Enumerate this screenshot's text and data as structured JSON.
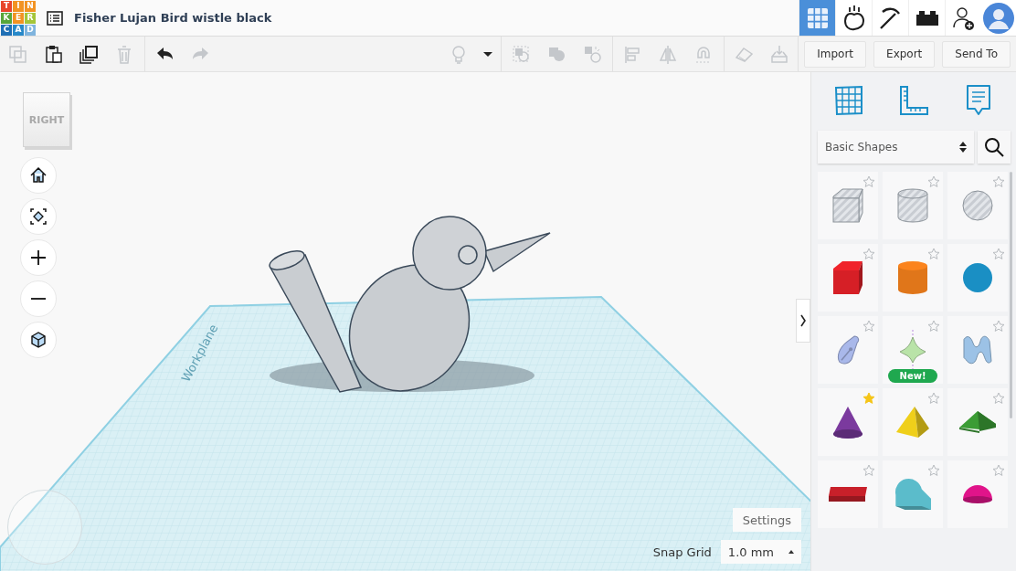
{
  "header": {
    "logo": [
      {
        "letter": "T",
        "color": "#e8452c"
      },
      {
        "letter": "I",
        "color": "#f29322"
      },
      {
        "letter": "N",
        "color": "#f29322"
      },
      {
        "letter": "K",
        "color": "#57a63a"
      },
      {
        "letter": "E",
        "color": "#f29322"
      },
      {
        "letter": "R",
        "color": "#a4c539"
      },
      {
        "letter": "C",
        "color": "#1f6fb5"
      },
      {
        "letter": "A",
        "color": "#2889c9"
      },
      {
        "letter": "D",
        "color": "#7fb4de"
      }
    ],
    "title": "Fisher Lujan Bird wistle black",
    "modes": [
      {
        "kind": "grid",
        "selected": true
      },
      {
        "kind": "apple",
        "selected": false
      },
      {
        "kind": "pickaxe",
        "selected": false
      },
      {
        "kind": "brick",
        "selected": false
      }
    ]
  },
  "toolbar": {
    "tools": [
      {
        "kind": "copy",
        "disabled": true
      },
      {
        "kind": "paste",
        "disabled": false
      },
      {
        "kind": "duplicate",
        "disabled": false
      },
      {
        "kind": "trash",
        "disabled": true
      },
      {
        "kind": "sep"
      },
      {
        "kind": "undo",
        "disabled": false
      },
      {
        "kind": "redo",
        "disabled": true
      }
    ],
    "tools_right": [
      {
        "kind": "bulb",
        "disabled": true
      },
      {
        "kind": "caret",
        "disabled": false
      },
      {
        "kind": "sep"
      },
      {
        "kind": "group",
        "disabled": true
      },
      {
        "kind": "ungroup",
        "disabled": true
      },
      {
        "kind": "hole",
        "disabled": true
      },
      {
        "kind": "sep"
      },
      {
        "kind": "align",
        "disabled": true
      },
      {
        "kind": "mirror",
        "disabled": true
      },
      {
        "kind": "magnet",
        "disabled": true
      },
      {
        "kind": "sep"
      },
      {
        "kind": "plane",
        "disabled": true
      },
      {
        "kind": "drop",
        "disabled": true
      }
    ],
    "buttons": [
      "Import",
      "Export",
      "Send To"
    ]
  },
  "viewcube": {
    "label": "RIGHT"
  },
  "nav": [
    {
      "kind": "home"
    },
    {
      "kind": "fit"
    },
    {
      "kind": "zoom-in"
    },
    {
      "kind": "zoom-out"
    },
    {
      "kind": "ortho"
    }
  ],
  "workplane": {
    "label": "Workplane"
  },
  "settings": "Settings",
  "snap": {
    "label": "Snap Grid",
    "value": "1.0 mm"
  },
  "library": {
    "category": "Basic Shapes",
    "shapes": [
      {
        "kind": "box",
        "color": "#c8ccd2",
        "hole": true,
        "starred": false
      },
      {
        "kind": "cylinder",
        "color": "#c8ccd2",
        "hole": true,
        "starred": false
      },
      {
        "kind": "sphere",
        "color": "#c8ccd2",
        "hole": true,
        "starred": false
      },
      {
        "kind": "box",
        "color": "#d61f26",
        "hole": false,
        "starred": false
      },
      {
        "kind": "cylinder",
        "color": "#e0761a",
        "hole": false,
        "starred": false
      },
      {
        "kind": "sphere",
        "color": "#1a8fc4",
        "hole": false,
        "starred": false
      },
      {
        "kind": "scribble",
        "color": "#a9b8ea",
        "hole": false,
        "starred": false
      },
      {
        "kind": "spinner",
        "color": "#b9e3a8",
        "hole": false,
        "starred": false,
        "badge": "New!"
      },
      {
        "kind": "wave",
        "color": "#9cc2e6",
        "hole": false,
        "starred": false
      },
      {
        "kind": "cone",
        "color": "#7b3a9e",
        "hole": false,
        "starred": true
      },
      {
        "kind": "pyramid",
        "color": "#efcf1a",
        "hole": false,
        "starred": false
      },
      {
        "kind": "roof",
        "color": "#3b9c35",
        "hole": false,
        "starred": false
      },
      {
        "kind": "text",
        "color": "#c8202a",
        "hole": false,
        "starred": false
      },
      {
        "kind": "halfcyl",
        "color": "#5bbccb",
        "hole": false,
        "starred": false
      },
      {
        "kind": "dome",
        "color": "#e0148a",
        "hole": false,
        "starred": false
      }
    ]
  }
}
